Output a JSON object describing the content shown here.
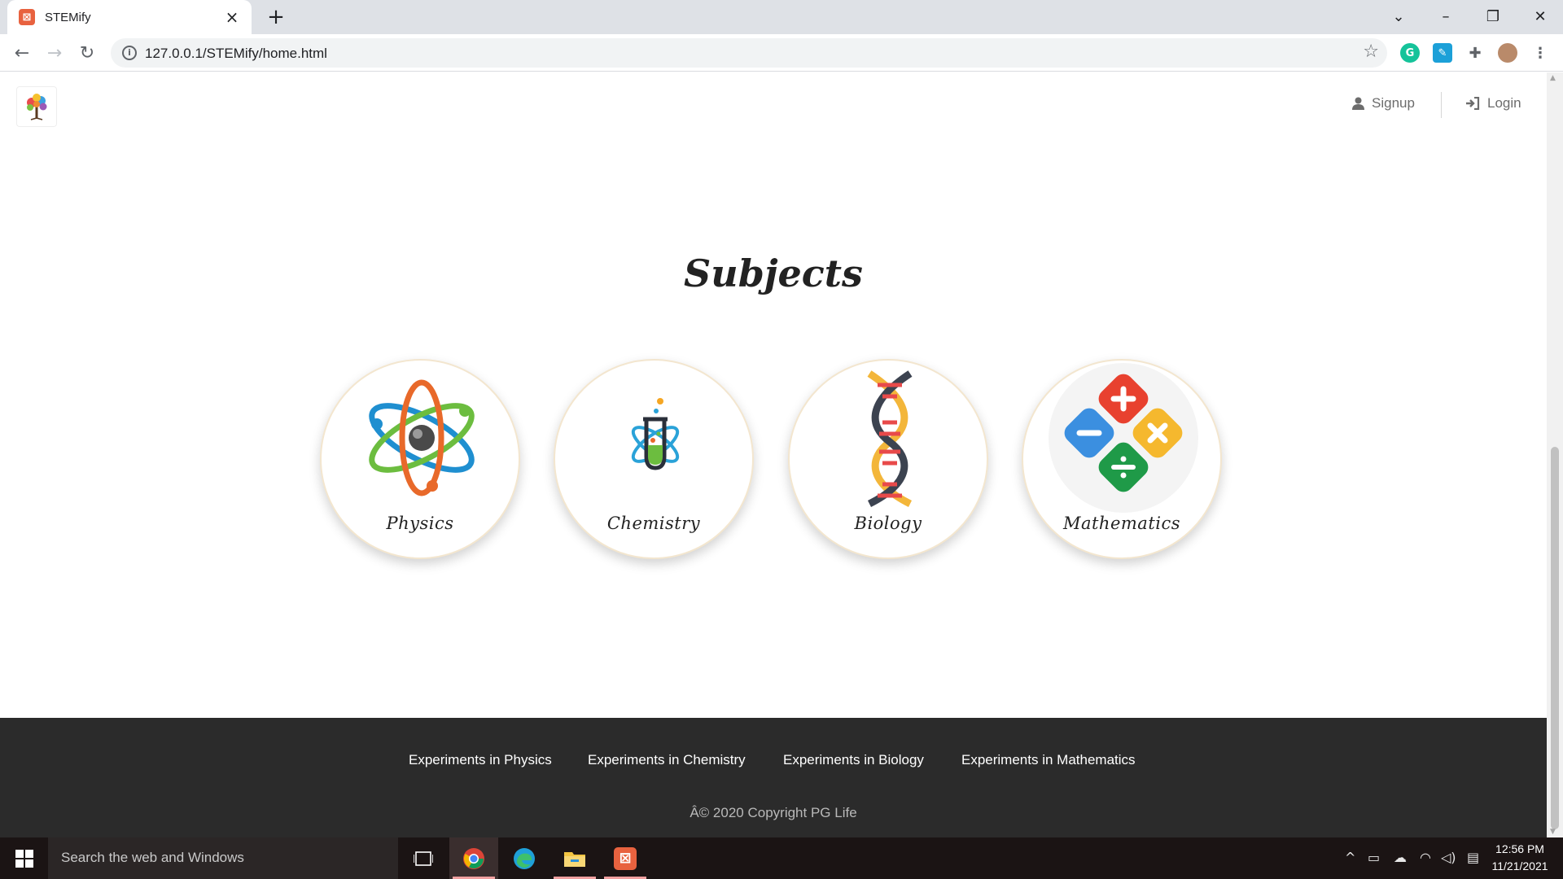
{
  "browser": {
    "tab_title": "STEMify",
    "tab_icon": "xampp-icon",
    "url": "127.0.0.1/STEMify/home.html"
  },
  "header": {
    "signup_label": "Signup",
    "login_label": "Login"
  },
  "main": {
    "title": "Subjects",
    "subjects": [
      {
        "label": "Physics",
        "icon": "atom-icon"
      },
      {
        "label": "Chemistry",
        "icon": "test-tube-atom-icon"
      },
      {
        "label": "Biology",
        "icon": "dna-icon"
      },
      {
        "label": "Mathematics",
        "icon": "math-operators-icon"
      }
    ]
  },
  "footer": {
    "links": [
      "Experiments in Physics",
      "Experiments in Chemistry",
      "Experiments in Biology",
      "Experiments in Mathematics"
    ],
    "copyright": "Â© 2020 Copyright PG Life"
  },
  "taskbar": {
    "search_placeholder": "Search the web and Windows",
    "time": "12:56 PM",
    "date": "11/21/2021"
  },
  "colors": {
    "footer_bg": "#2b2b2b",
    "nav_text": "#6c6c6c",
    "card_border": "#f3e6cf"
  }
}
